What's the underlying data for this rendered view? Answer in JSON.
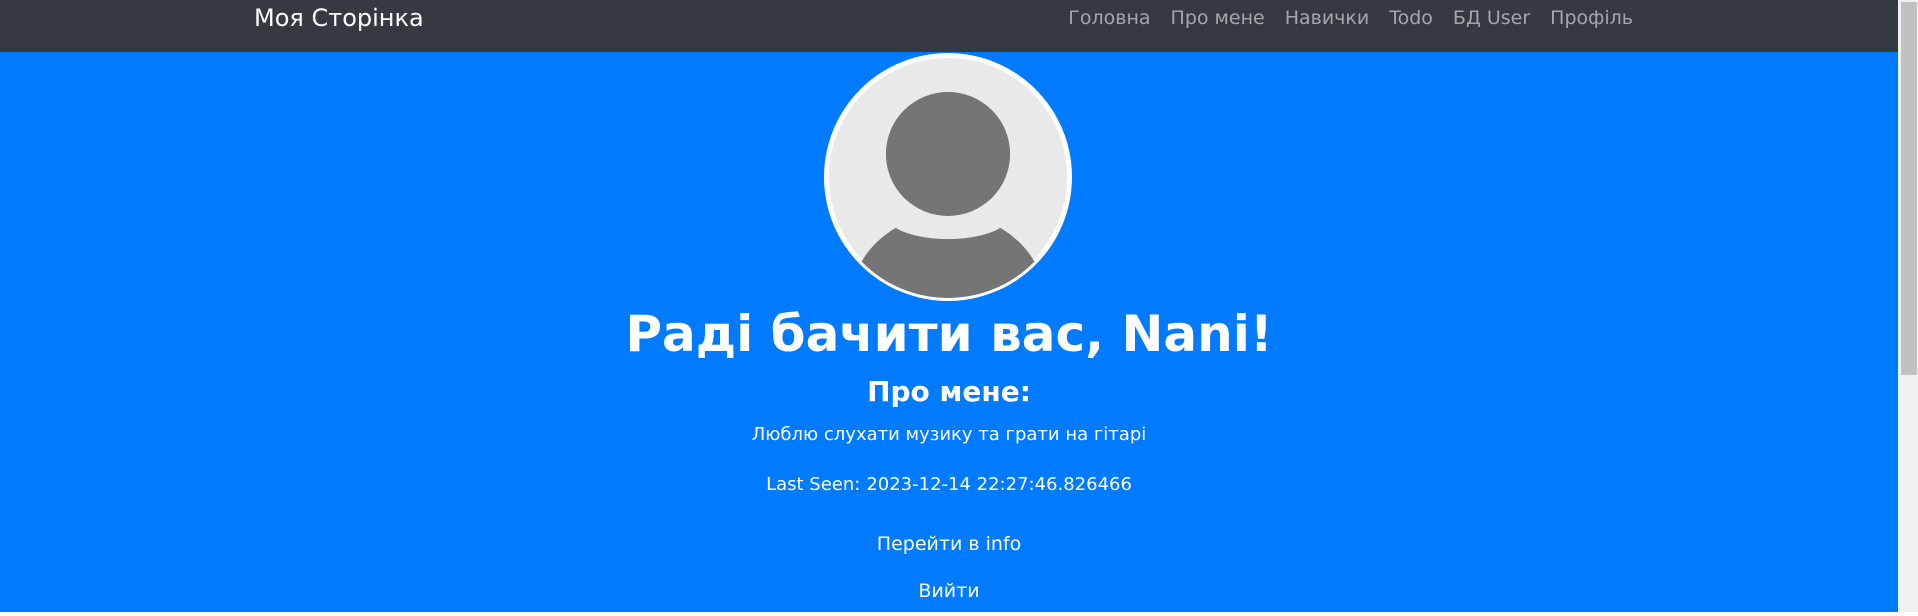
{
  "navbar": {
    "brand": "Моя Сторінка",
    "links": [
      {
        "label": "Головна"
      },
      {
        "label": "Про мене"
      },
      {
        "label": "Навички"
      },
      {
        "label": "Todo"
      },
      {
        "label": "БД User"
      },
      {
        "label": "Профіль"
      }
    ]
  },
  "profile": {
    "avatar_icon": "user-placeholder-icon",
    "greeting": "Раді бачити вас, Nani!",
    "about_heading": "Про мене:",
    "about_text": "Люблю слухати музику та грати на гітарі",
    "last_seen_label": "Last Seen:",
    "last_seen_value": "2023-12-14 22:27:46.826466"
  },
  "actions": {
    "info_link": "Перейти в info",
    "logout_link": "Вийти"
  },
  "colors": {
    "navbar_bg": "#343a40",
    "page_bg": "#007bff",
    "avatar_bg": "#e9e9e9",
    "avatar_figure": "#757575"
  }
}
